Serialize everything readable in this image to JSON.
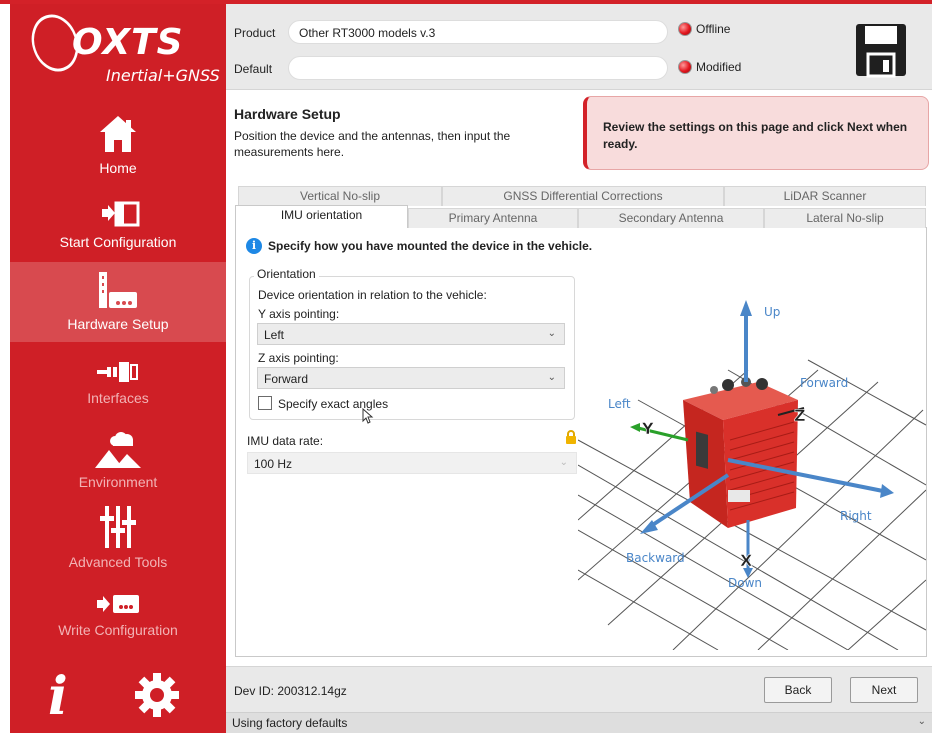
{
  "sidebar": {
    "logo_text": "OXTS",
    "logo_sub": "Inertial+GNSS",
    "items": [
      {
        "label": "Home",
        "icon": "home-icon"
      },
      {
        "label": "Start Configuration",
        "icon": "start-configuration-icon"
      },
      {
        "label": "Hardware Setup",
        "icon": "hardware-setup-icon"
      },
      {
        "label": "Interfaces",
        "icon": "interfaces-icon"
      },
      {
        "label": "Environment",
        "icon": "environment-icon"
      },
      {
        "label": "Advanced Tools",
        "icon": "advanced-tools-icon"
      },
      {
        "label": "Write Configuration",
        "icon": "write-configuration-icon"
      }
    ],
    "info_glyph": "i"
  },
  "header": {
    "product_label": "Product",
    "product_value": "Other RT3000 models v.3",
    "default_label": "Default",
    "default_value": "",
    "status_offline": "Offline",
    "status_modified": "Modified"
  },
  "page": {
    "title": "Hardware Setup",
    "description": "Position the device and the antennas, then input the measurements here.",
    "notice": "Review the settings on this page and click Next when ready."
  },
  "tabs": {
    "back_row": [
      "Vertical No-slip",
      "GNSS Differential Corrections",
      "LiDAR Scanner"
    ],
    "front_row": [
      "IMU orientation",
      "Primary Antenna",
      "Secondary Antenna",
      "Lateral No-slip"
    ],
    "active": "IMU orientation"
  },
  "imu": {
    "hint": "Specify how you have mounted the device in the vehicle.",
    "group_title": "Orientation",
    "orientation_desc": "Device orientation in relation to the vehicle:",
    "y_label": "Y axis pointing:",
    "y_value": "Left",
    "z_label": "Z axis pointing:",
    "z_value": "Forward",
    "exact_angles_label": "Specify exact angles",
    "exact_angles_checked": false,
    "rate_label": "IMU data rate:",
    "rate_value": "100 Hz"
  },
  "viz": {
    "labels": {
      "up": "Up",
      "forward": "Forward",
      "left": "Left",
      "right": "Right",
      "backward": "Backward",
      "down": "Down"
    },
    "axes": {
      "x": "X",
      "y": "Y",
      "z": "Z"
    },
    "colors": {
      "direction_arrow": "#4a86c8",
      "y_axis": "#2aa02a",
      "z_axis": "#222222",
      "device": "#d9302a"
    }
  },
  "footer": {
    "dev_id": "Dev ID: 200312.14gz",
    "back": "Back",
    "next": "Next",
    "status": "Using factory defaults"
  }
}
